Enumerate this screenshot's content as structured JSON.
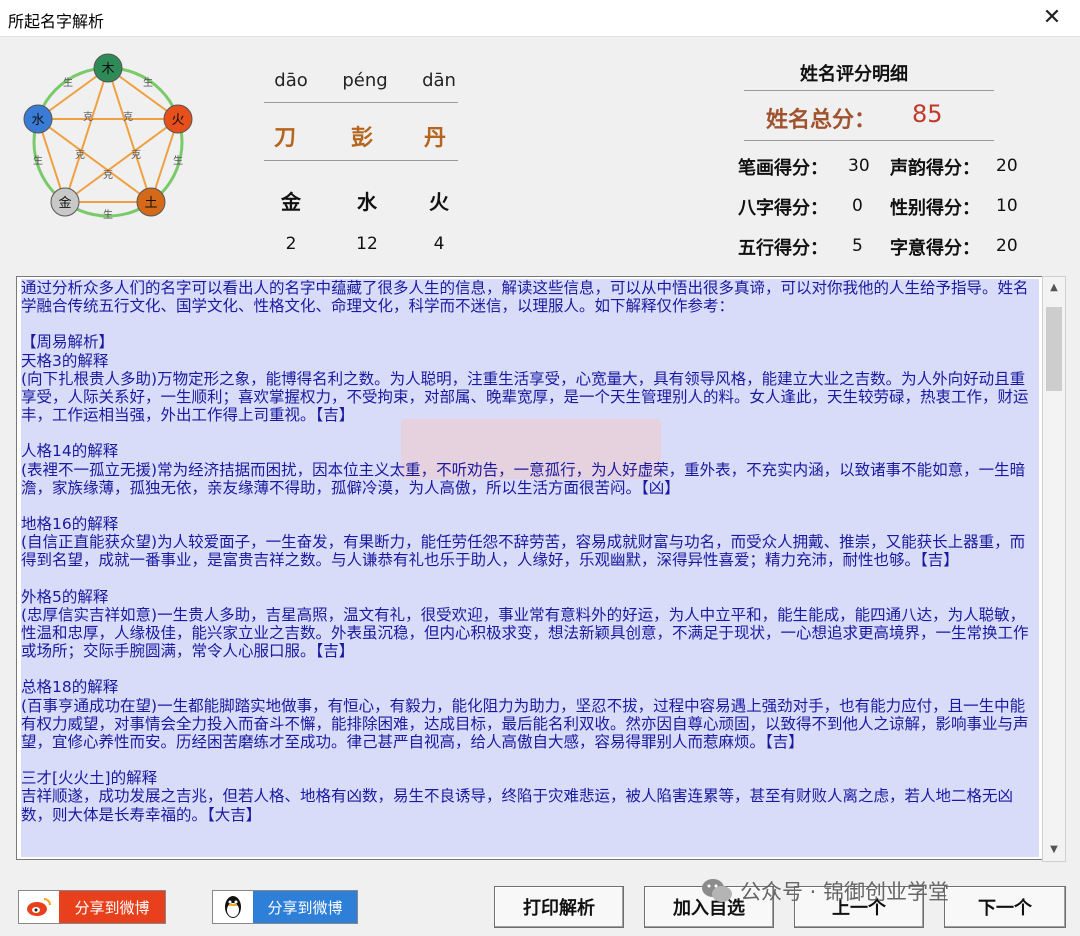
{
  "window": {
    "title": "所起名字解析",
    "close": "✕"
  },
  "name": {
    "pinyin": [
      "dāo",
      "péng",
      "dān"
    ],
    "chars": [
      "刀",
      "彭",
      "丹"
    ],
    "elements": [
      "金",
      "水",
      "火"
    ],
    "strokes": [
      "2",
      "12",
      "4"
    ]
  },
  "wheel": {
    "nodes": [
      "木",
      "火",
      "土",
      "金",
      "水"
    ],
    "node_colors": [
      "#2e8b57",
      "#e8501b",
      "#d4691a",
      "#c8c8c8",
      "#3a7bd5"
    ],
    "outer_labels": [
      "生",
      "生",
      "生",
      "生",
      "生"
    ],
    "inner_labels": [
      "克",
      "克",
      "克",
      "克",
      "克"
    ]
  },
  "score": {
    "title": "姓名评分明细",
    "total_label": "姓名总分：",
    "total_value": "85",
    "items": [
      {
        "label": "笔画得分：",
        "value": "30"
      },
      {
        "label": "声韵得分：",
        "value": "20"
      },
      {
        "label": "八字得分：",
        "value": "0"
      },
      {
        "label": "性别得分：",
        "value": "10"
      },
      {
        "label": "五行得分：",
        "value": "5"
      },
      {
        "label": "字意得分：",
        "value": "20"
      }
    ]
  },
  "analysis": {
    "paragraphs": [
      "通过分析众多人们的名字可以看出人的名字中蕴藏了很多人生的信息，解读这些信息，可以从中悟出很多真谛，可以对你我他的人生给予指导。姓名学融合传统五行文化、国学文化、性格文化、命理文化，科学而不迷信，以理服人。如下解释仅作参考：",
      "【周易解析】\n天格3的解释\n(向下扎根贵人多助)万物定形之象，能博得名利之数。为人聪明，注重生活享受，心宽量大，具有领导风格，能建立大业之吉数。为人外向好动且重享受，人际关系好，一生顺利；喜欢掌握权力，不受拘束，对部属、晚辈宽厚，是一个天生管理别人的料。女人逢此，天生较劳碌，热衷工作，财运丰，工作运相当强，外出工作得上司重视。【吉】",
      "人格14的解释\n(表裡不一孤立无援)常为经济拮据而困扰，因本位主义太重，不听劝告，一意孤行，为人好虚荣，重外表，不充实内涵，以致诸事不能如意，一生暗澹，家族缘薄，孤独无依，亲友缘薄不得助，孤僻冷漠，为人高傲，所以生活方面很苦闷。【凶】",
      "地格16的解释\n(自信正直能获众望)为人较爱面子，一生奋发，有果断力，能任劳任怨不辞劳苦，容易成就财富与功名，而受众人拥戴、推崇，又能获长上器重，而得到名望，成就一番事业，是富贵吉祥之数。与人谦恭有礼也乐于助人，人缘好，乐观幽默，深得异性喜爱；精力充沛，耐性也够。【吉】",
      "外格5的解释\n(忠厚信实吉祥如意)一生贵人多助，吉星高照，温文有礼，很受欢迎，事业常有意料外的好运，为人中立平和，能生能成，能四通八达，为人聪敏，性温和忠厚，人缘极佳，能兴家立业之吉数。外表虽沉稳，但内心积极求变，想法新颖具创意，不满足于现状，一心想追求更高境界，一生常换工作或场所；交际手腕圆满，常令人心服口服。【吉】",
      "总格18的解释\n(百事亨通成功在望)一生都能脚踏实地做事，有恒心，有毅力，能化阻力为助力，坚忍不拔，过程中容易遇上强劲对手，也有能力应付，且一生中能有权力威望，对事情会全力投入而奋斗不懈，能排除困难，达成目标，最后能名利双收。然亦因自尊心顽固，以致得不到他人之谅解，影响事业与声望，宜修心养性而安。历经困苦磨练才至成功。律己甚严自视高，给人高傲自大感，容易得罪别人而惹麻烦。【吉】",
      "三才[火火土]的解释\n吉祥顺遂，成功发展之吉兆，但若人格、地格有凶数，易生不良诱导，终陷于灾难悲运，被人陷害连累等，甚至有财败人离之虑，若人地二格无凶数，则大体是长寿幸福的。【大吉】"
    ]
  },
  "buttons": {
    "share_weibo_red": "分享到微博",
    "share_weibo_blue": "分享到微博",
    "print": "打印解析",
    "add_fav": "加入自选",
    "prev": "上一个",
    "next": "下一个"
  },
  "watermark_text": "公众号 · 锦御创业学堂"
}
